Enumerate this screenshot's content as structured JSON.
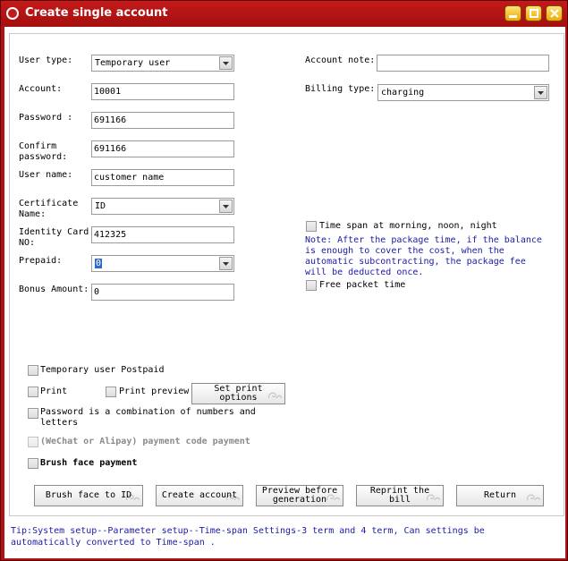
{
  "window": {
    "title": "Create single account"
  },
  "form": {
    "user_type_label": "User type:",
    "user_type_value": "Temporary user",
    "account_label": "Account:",
    "account_value": "10001",
    "password_label": "Password :",
    "password_value": "691166",
    "confirm_label": "Confirm\npassword:",
    "confirm_value": "691166",
    "username_label": "User name:",
    "username_value": "customer name",
    "cert_name_label": "Certificate\nName:",
    "cert_name_value": "ID",
    "id_card_label": "Identity Card\nNO:",
    "id_card_value": "412325",
    "prepaid_label": "Prepaid:",
    "prepaid_value": "0",
    "bonus_label": "Bonus Amount:",
    "bonus_value": "0",
    "account_note_label": "Account note:",
    "account_note_value": "",
    "billing_type_label": "Billing type:",
    "billing_type_value": "charging",
    "timespan_label": "Time span at morning, noon, night",
    "timespan_note": "Note: After the package time, if the balance is enough to cover the cost, when the automatic subcontracting, the package fee will be deducted once.",
    "free_packet_label": "Free packet time"
  },
  "options": {
    "temp_postpaid": "Temporary user Postpaid",
    "print": "Print",
    "print_preview": "Print preview",
    "set_print_options": "Set print\noptions",
    "password_combo": "Password is a combination of numbers and letters",
    "wechat_payment": "(WeChat or Alipay) payment code payment",
    "brush_face_payment": "Brush face payment"
  },
  "buttons": {
    "brush_face": "Brush face to ID",
    "create": "Create account",
    "preview": "Preview before\ngeneration",
    "reprint": "Reprint the\nbill",
    "return": "Return"
  },
  "tip": "Tip:System setup--Parameter setup--Time-span Settings-3 term and 4 term, Can settings be automatically converted to Time-span .",
  "colors": {
    "window_frame": "#b11212",
    "note_text": "#1a1aa8",
    "title_buttons": "#f0a800"
  }
}
